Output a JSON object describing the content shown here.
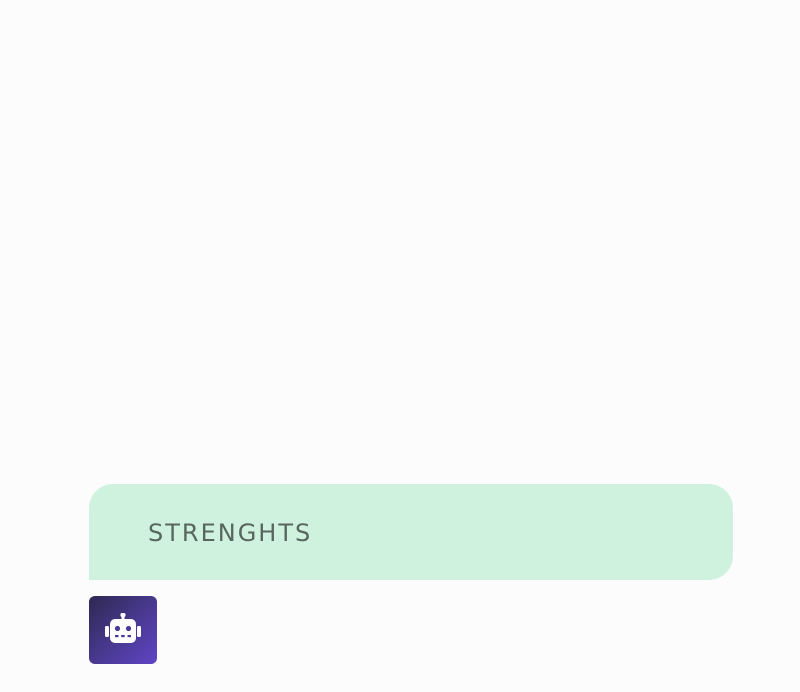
{
  "chat": {
    "section_title": "STRENGHTS",
    "bot_avatar_icon": "robot-icon"
  },
  "colors": {
    "background": "#fcfcfd",
    "section_card": "#cff2df",
    "section_title_text": "#58665e",
    "avatar_gradient_start": "#2e2850",
    "avatar_gradient_end": "#6044c4"
  }
}
